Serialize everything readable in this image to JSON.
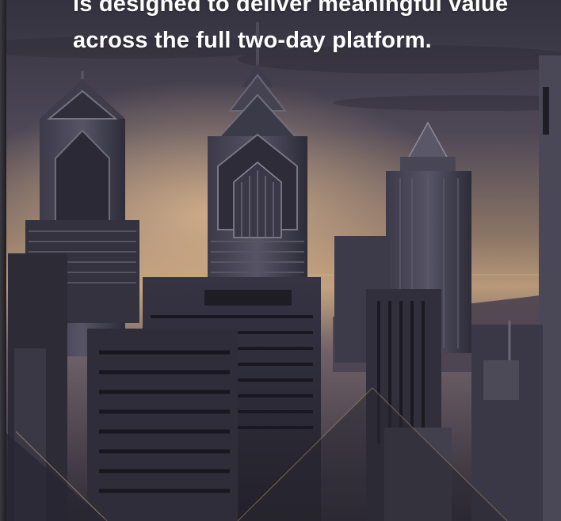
{
  "caption": {
    "line1": "is designed to deliver meaningful value",
    "line2": "across the full two-day platform."
  },
  "colors": {
    "sky_top": "#3f3c4d",
    "sky_glow": "#c9a784",
    "building_dark": "#2b2a36",
    "building_mid": "#4a4856",
    "accent_gold": "#b8956a"
  },
  "scene": {
    "subject": "city-skyline-illustration"
  }
}
